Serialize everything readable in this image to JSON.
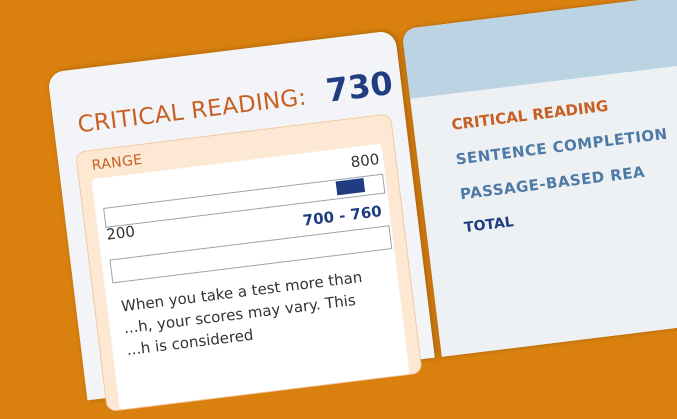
{
  "score_card": {
    "section_label": "CRITICAL READING:",
    "score": "730",
    "range": {
      "label": "RANGE",
      "min_label": "200",
      "max_label": "800",
      "score_range": "700 - 760",
      "fill_start_fraction": 0.833,
      "fill_end_fraction": 0.933
    },
    "note_lines": [
      "When you take a test more than",
      "...h, your scores may vary. This",
      "...h is considered"
    ]
  },
  "breakdown": {
    "heading": "CRITICAL READING",
    "rows": [
      "SENTENCE COMPLETION",
      "PASSAGE-BASED REA"
    ],
    "total": "TOTAL"
  },
  "colors": {
    "background": "#d9800f",
    "accent_orange": "#c95f22",
    "score_blue": "#1f3d80",
    "sub_blue": "#4e7aa6",
    "range_bg": "#fde8d4",
    "header_blue": "#bcd3e4"
  }
}
